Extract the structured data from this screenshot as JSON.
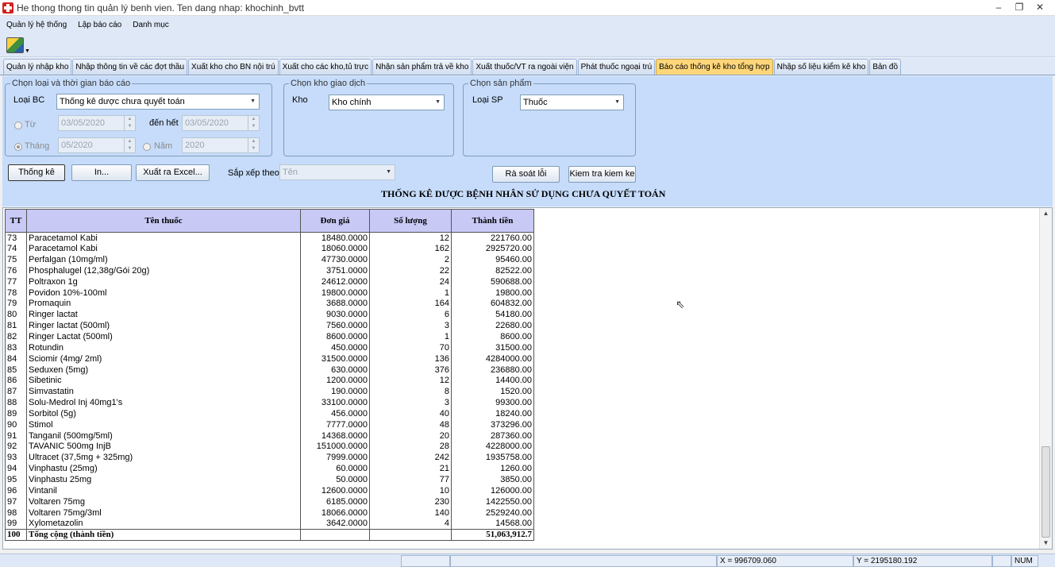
{
  "window": {
    "title": "He thong thong tin quản lý benh vien. Ten dang nhap: khochinh_bvtt",
    "min": "–",
    "max": "❐",
    "close": "✕"
  },
  "menu": [
    "Quản lý hệ thống",
    "Lập báo cáo",
    "Danh mục"
  ],
  "tabs": [
    "Quản lý nhập kho",
    "Nhập thông tin về các đợt thầu",
    "Xuất kho cho BN nội trú",
    "Xuất cho các kho,tủ trực",
    "Nhận sản phẩm trả về kho",
    "Xuất thuốc/VT ra ngoài viện",
    "Phát thuốc ngoại trú",
    "Báo cáo thống kê kho tổng hợp",
    "Nhập số liệu kiểm kê kho",
    "Bản đồ"
  ],
  "report_group": {
    "title": "Chọn loại và thời gian báo cáo",
    "loai_bc_label": "Loại BC",
    "loai_bc_value": "Thống kê dược chưa quyết toán",
    "tu_label": "Từ",
    "tu_value": "03/05/2020",
    "den_het_label": "đến hết",
    "den_het_value": "03/05/2020",
    "thang_label": "Tháng",
    "thang_value": "05/2020",
    "nam_label": "Năm",
    "nam_value": "2020"
  },
  "kho_group": {
    "title": "Chọn kho giao dịch",
    "label": "Kho",
    "value": "Kho chính"
  },
  "sp_group": {
    "title": "Chọn sản phẩm",
    "label": "Loại SP",
    "value": "Thuốc"
  },
  "buttons": {
    "thong_ke": "Thống kê",
    "in": "In...",
    "excel": "Xuất ra Excel...",
    "sort_label": "Sắp xếp theo",
    "sort_value": "Tên",
    "ra_soat": "Rà soát lỗi",
    "kiem_tra": "Kiem tra kiem ke"
  },
  "report_title": "THỐNG KÊ DƯỢC BỆNH NHÂN SỬ DỤNG CHƯA QUYẾT TOÁN",
  "table": {
    "headers": [
      "TT",
      "Tên thuốc",
      "Đơn giá",
      "Số lượng",
      "Thành tiền"
    ],
    "rows": [
      [
        "73",
        "Paracetamol Kabi",
        "18480.0000",
        "12",
        "221760.00"
      ],
      [
        "74",
        "Paracetamol Kabi",
        "18060.0000",
        "162",
        "2925720.00"
      ],
      [
        "75",
        "Perfalgan (10mg/ml)",
        "47730.0000",
        "2",
        "95460.00"
      ],
      [
        "76",
        "Phosphalugel (12,38g/Gói 20g)",
        "3751.0000",
        "22",
        "82522.00"
      ],
      [
        "77",
        "Poltraxon 1g",
        "24612.0000",
        "24",
        "590688.00"
      ],
      [
        "78",
        "Povidon 10%-100ml",
        "19800.0000",
        "1",
        "19800.00"
      ],
      [
        "79",
        "Promaquin",
        "3688.0000",
        "164",
        "604832.00"
      ],
      [
        "80",
        "Ringer lactat",
        "9030.0000",
        "6",
        "54180.00"
      ],
      [
        "81",
        "Ringer lactat (500ml)",
        "7560.0000",
        "3",
        "22680.00"
      ],
      [
        "82",
        "Ringer Lactat (500ml)",
        "8600.0000",
        "1",
        "8600.00"
      ],
      [
        "83",
        "Rotundin",
        "450.0000",
        "70",
        "31500.00"
      ],
      [
        "84",
        "Sciomir (4mg/ 2ml)",
        "31500.0000",
        "136",
        "4284000.00"
      ],
      [
        "85",
        "Seduxen (5mg)",
        "630.0000",
        "376",
        "236880.00"
      ],
      [
        "86",
        "Sibetinic",
        "1200.0000",
        "12",
        "14400.00"
      ],
      [
        "87",
        "Simvastatin",
        "190.0000",
        "8",
        "1520.00"
      ],
      [
        "88",
        "Solu-Medrol Inj 40mg1's",
        "33100.0000",
        "3",
        "99300.00"
      ],
      [
        "89",
        "Sorbitol (5g)",
        "456.0000",
        "40",
        "18240.00"
      ],
      [
        "90",
        "Stimol",
        "7777.0000",
        "48",
        "373296.00"
      ],
      [
        "91",
        "Tanganil (500mg/5ml)",
        "14368.0000",
        "20",
        "287360.00"
      ],
      [
        "92",
        "TAVANIC 500mg InjB",
        "151000.0000",
        "28",
        "4228000.00"
      ],
      [
        "93",
        "Ultracet (37,5mg + 325mg)",
        "7999.0000",
        "242",
        "1935758.00"
      ],
      [
        "94",
        "Vinphastu (25mg)",
        "60.0000",
        "21",
        "1260.00"
      ],
      [
        "95",
        "Vinphastu 25mg",
        "50.0000",
        "77",
        "3850.00"
      ],
      [
        "96",
        "Vintanil",
        "12600.0000",
        "10",
        "126000.00"
      ],
      [
        "97",
        "Voltaren 75mg",
        "6185.0000",
        "230",
        "1422550.00"
      ],
      [
        "98",
        "Voltaren 75mg/3ml",
        "18066.0000",
        "140",
        "2529240.00"
      ],
      [
        "99",
        "Xylometazolin",
        "3642.0000",
        "4",
        "14568.00"
      ]
    ],
    "total_tt": "100",
    "total_label": "Tổng cộng (thành tiền)",
    "total_value": "51,063,912.7"
  },
  "status": {
    "x": "X = 996709.060",
    "y": "Y = 2195180.192",
    "num": "NUM"
  }
}
